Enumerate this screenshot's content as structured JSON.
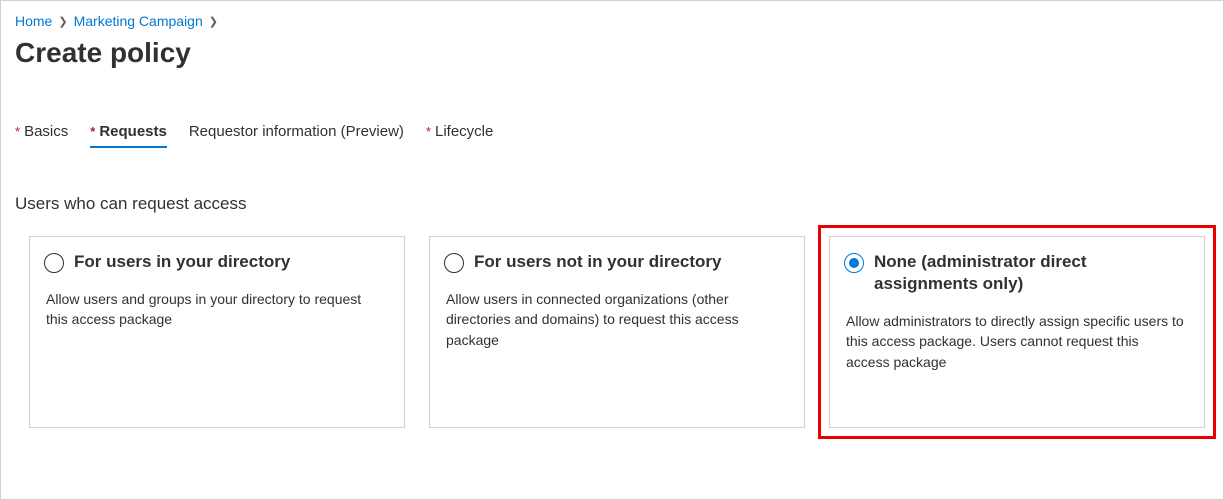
{
  "breadcrumb": {
    "items": [
      {
        "label": "Home"
      },
      {
        "label": "Marketing Campaign"
      }
    ]
  },
  "page_title": "Create policy",
  "tabs": [
    {
      "label": "Basics",
      "required": true,
      "active": false
    },
    {
      "label": "Requests",
      "required": true,
      "active": true
    },
    {
      "label": "Requestor information (Preview)",
      "required": false,
      "active": false
    },
    {
      "label": "Lifecycle",
      "required": true,
      "active": false
    }
  ],
  "section_heading": "Users who can request access",
  "options": [
    {
      "title": "For users in your directory",
      "description": "Allow users and groups in your directory to request this access package",
      "selected": false,
      "highlight": false
    },
    {
      "title": "For users not in your directory",
      "description": "Allow users in connected organizations (other directories and domains) to request this access package",
      "selected": false,
      "highlight": false
    },
    {
      "title": "None (administrator direct assignments only)",
      "description": "Allow administrators to directly assign specific users to this access package. Users cannot request this access package",
      "selected": true,
      "highlight": true
    }
  ]
}
